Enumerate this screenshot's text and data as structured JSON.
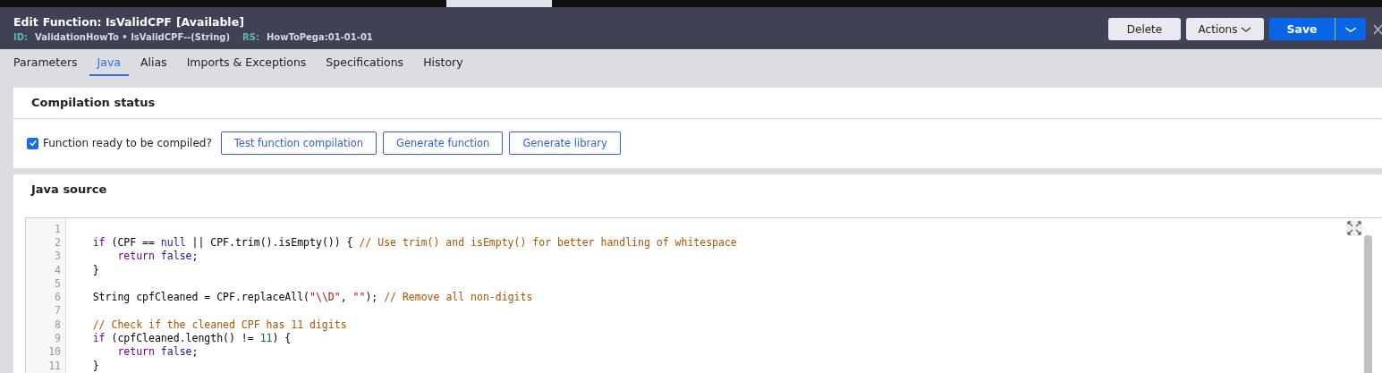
{
  "header": {
    "edit_label": "Edit",
    "title": "Function: IsValidCPF",
    "status": "[Available]",
    "id_label": "ID:",
    "id_value": "ValidationHowTo • IsValidCPF--(String)",
    "rs_label": "RS:",
    "rs_value": "HowToPega:01-01-01"
  },
  "actions": {
    "delete": "Delete",
    "actions": "Actions",
    "save": "Save"
  },
  "tabs": [
    {
      "label": "Parameters",
      "selected": false
    },
    {
      "label": "Java",
      "selected": true
    },
    {
      "label": "Alias",
      "selected": false
    },
    {
      "label": "Imports & Exceptions",
      "selected": false
    },
    {
      "label": "Specifications",
      "selected": false
    },
    {
      "label": "History",
      "selected": false
    }
  ],
  "compilation": {
    "title": "Compilation status",
    "ready_label": "Function ready to be compiled?",
    "ready_checked": true,
    "buttons": [
      "Test function compilation",
      "Generate function",
      "Generate library"
    ]
  },
  "java_source": {
    "title": "Java source",
    "lines": [
      {
        "number": "1"
      },
      {
        "number": "2",
        "tokens": [
          {
            "kind": "keyword",
            "text": "    if"
          },
          {
            "kind": "plain",
            "text": " (CPF == "
          },
          {
            "kind": "literal",
            "text": "null"
          },
          {
            "kind": "plain",
            "text": " || CPF.trim().isEmpty()) { "
          },
          {
            "kind": "comment",
            "text": "// Use trim() and isEmpty() for better handling of whitespace"
          }
        ]
      },
      {
        "number": "3",
        "tokens": [
          {
            "kind": "keyword",
            "text": "        return "
          },
          {
            "kind": "literal",
            "text": "false"
          },
          {
            "kind": "plain",
            "text": ";"
          }
        ]
      },
      {
        "number": "4",
        "tokens": [
          {
            "kind": "plain",
            "text": "    }"
          }
        ]
      },
      {
        "number": "5"
      },
      {
        "number": "6",
        "tokens": [
          {
            "kind": "plain",
            "text": "    String cpfCleaned = CPF.replaceAll("
          },
          {
            "kind": "string",
            "text": "\"\\\\D\""
          },
          {
            "kind": "plain",
            "text": ", "
          },
          {
            "kind": "string",
            "text": "\"\""
          },
          {
            "kind": "plain",
            "text": "); "
          },
          {
            "kind": "comment",
            "text": "// Remove all non-digits"
          }
        ]
      },
      {
        "number": "7"
      },
      {
        "number": "8",
        "tokens": [
          {
            "kind": "comment",
            "text": "    // Check if the cleaned CPF has 11 digits"
          }
        ]
      },
      {
        "number": "9",
        "tokens": [
          {
            "kind": "keyword",
            "text": "    if"
          },
          {
            "kind": "plain",
            "text": " (cpfCleaned.length() != "
          },
          {
            "kind": "number",
            "text": "11"
          },
          {
            "kind": "plain",
            "text": ") {"
          }
        ]
      },
      {
        "number": "10",
        "tokens": [
          {
            "kind": "keyword",
            "text": "        return "
          },
          {
            "kind": "literal",
            "text": "false"
          },
          {
            "kind": "plain",
            "text": ";"
          }
        ]
      },
      {
        "number": "11",
        "tokens": [
          {
            "kind": "plain",
            "text": "    }"
          }
        ]
      }
    ]
  }
}
